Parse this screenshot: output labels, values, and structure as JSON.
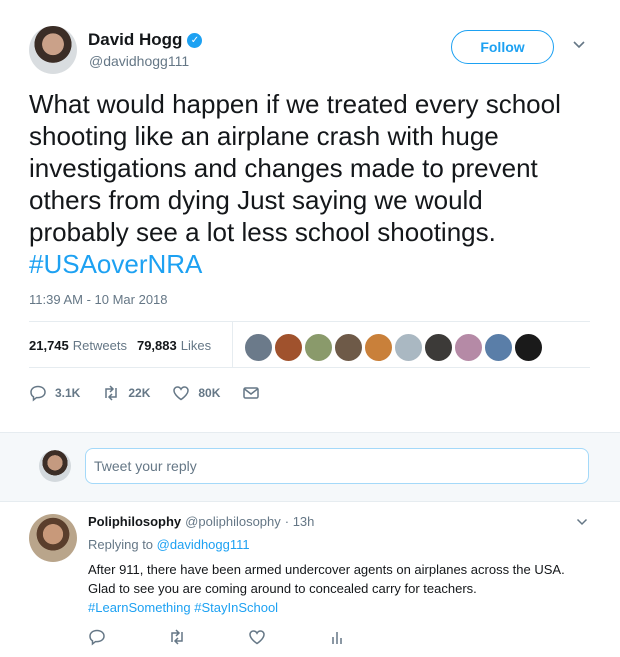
{
  "author": {
    "name": "David Hogg",
    "handle": "@davidhogg111"
  },
  "follow_label": "Follow",
  "tweet": {
    "text": "What would happen if we treated every school shooting like an airplane crash with huge investigations and changes made to prevent others from dying Just saying we would probably see a lot less school shootings.",
    "hashtag": "#USAoverNRA",
    "timestamp": "11:39 AM - 10 Mar 2018"
  },
  "stats": {
    "retweets_count": "21,745",
    "retweets_label": "Retweets",
    "likes_count": "79,883",
    "likes_label": "Likes"
  },
  "actions": {
    "replies": "3.1K",
    "retweets": "22K",
    "likes": "80K"
  },
  "composer": {
    "placeholder": "Tweet your reply"
  },
  "reply": {
    "name": "Poliphilosophy",
    "handle": "@poliphilosophy",
    "time": "· 13h",
    "replying_prefix": "Replying to",
    "replying_to": "@davidhogg111",
    "text": "After 911, there have been armed undercover agents on airplanes across the USA. Glad to see you are coming around to concealed carry for teachers.",
    "hashtags": "#LearnSomething #StayInSchool"
  },
  "colors": {
    "accent": "#1da1f2",
    "muted": "#657786",
    "text": "#14171a"
  }
}
